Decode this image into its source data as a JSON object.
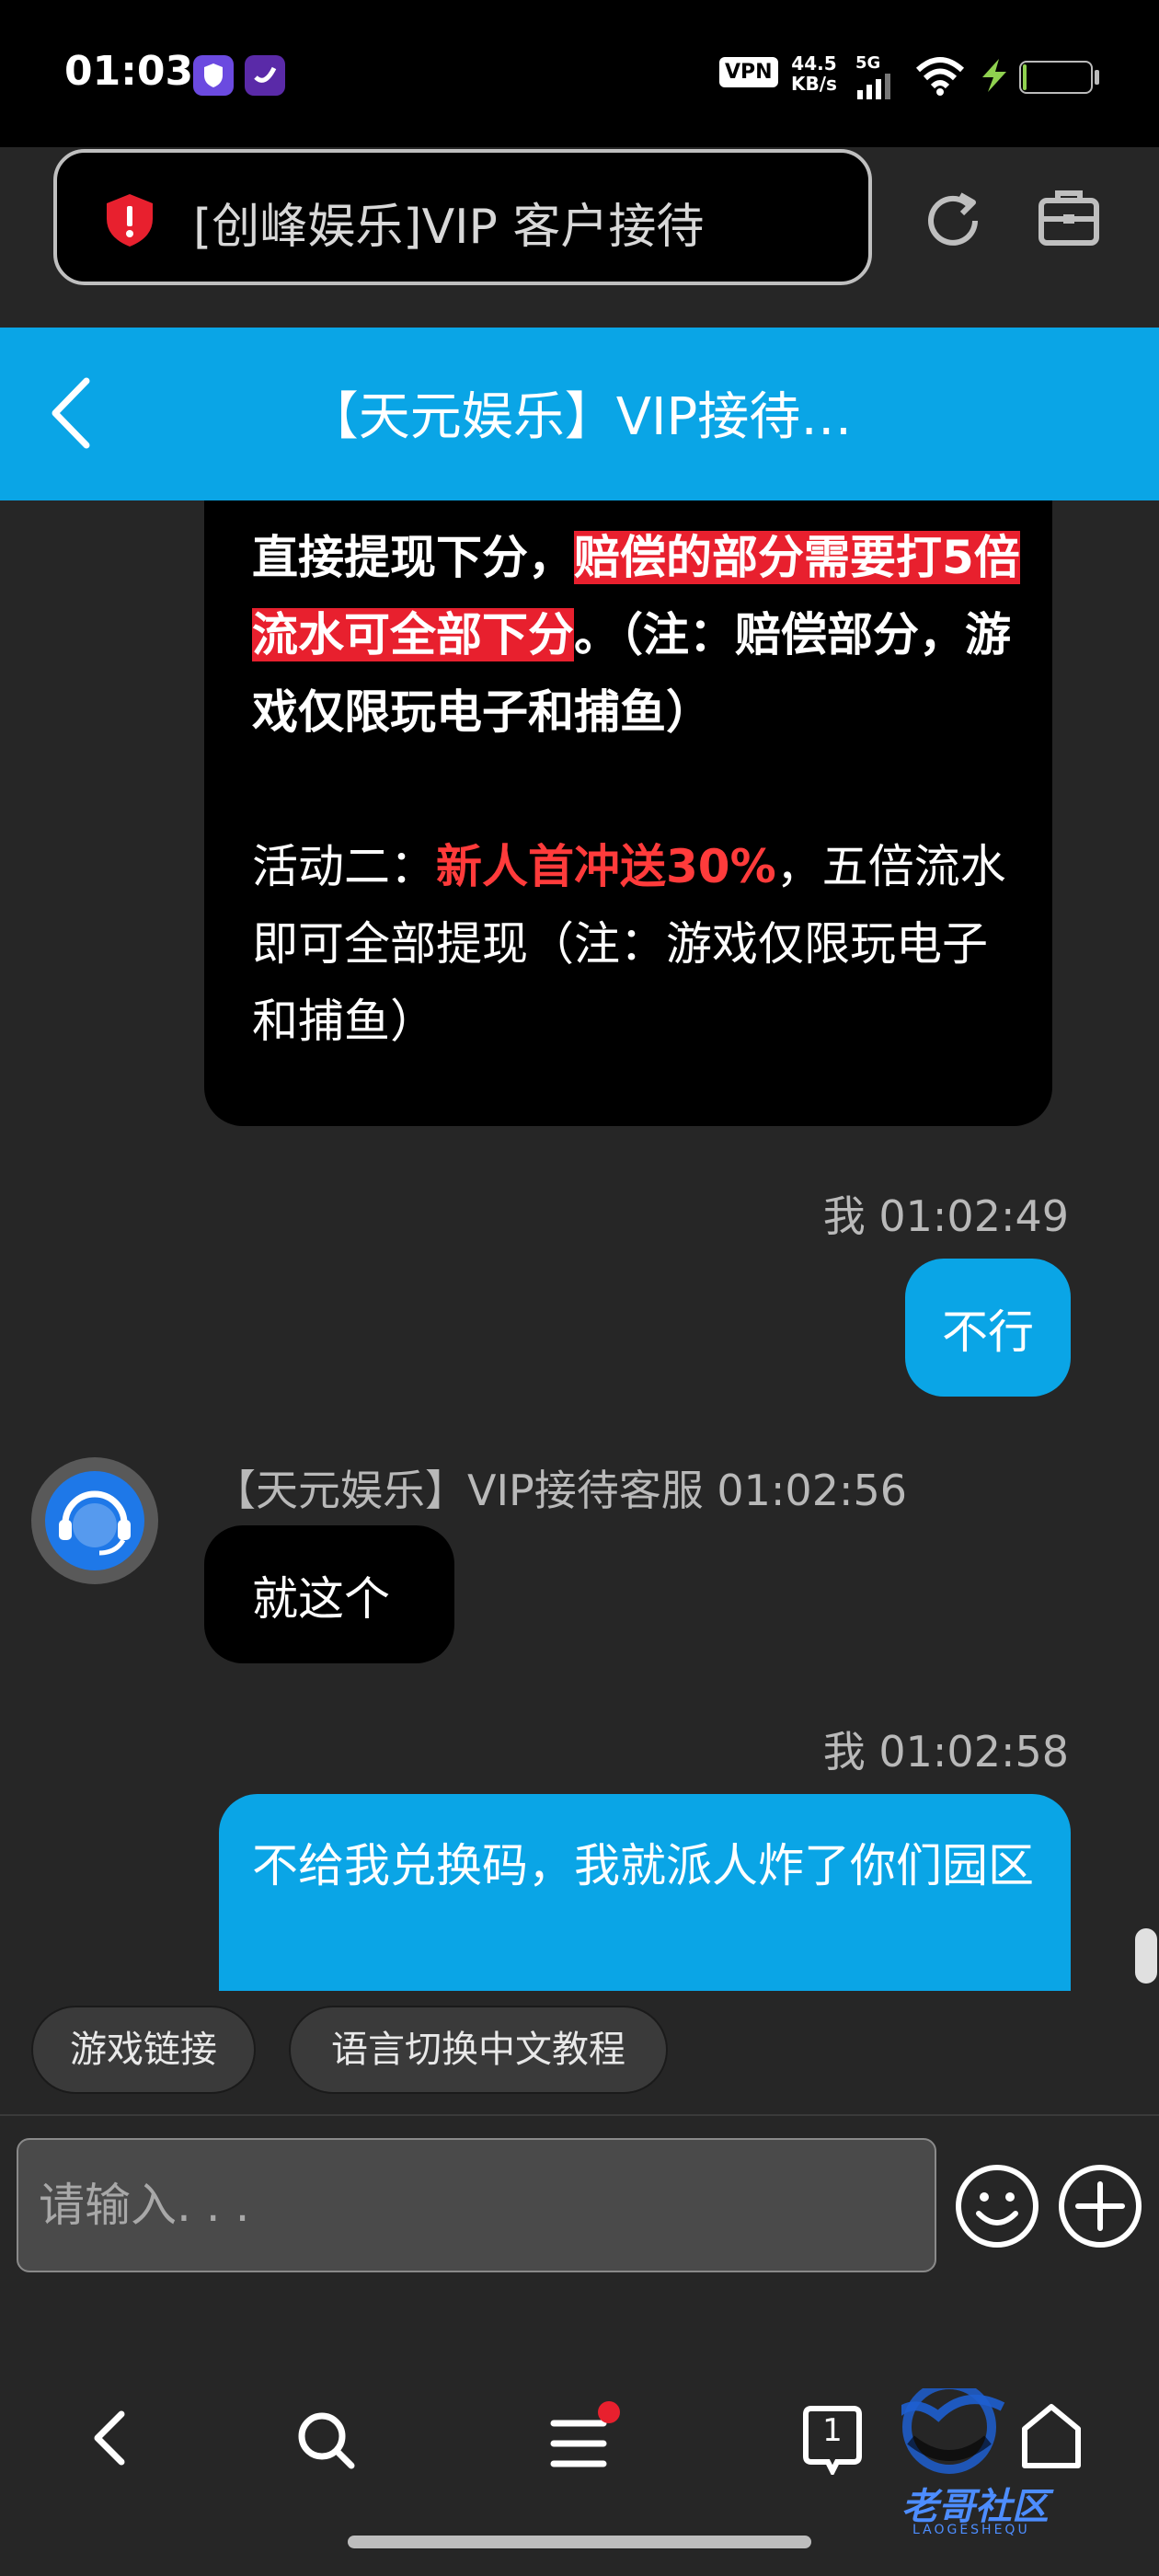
{
  "status_bar": {
    "time": "01:03",
    "vpn_label": "VPN",
    "net_speed_value": "44.5",
    "net_speed_unit": "KB/s",
    "signal_label": "5G",
    "battery_level": "11",
    "battery_fraction": 0.11
  },
  "browser": {
    "page_title": "[创峰娱乐]VIP 客户接待",
    "icons": [
      "shield-alert-icon",
      "refresh-icon",
      "briefcase-icon"
    ]
  },
  "chat_header": {
    "title": "【天元娱乐】VIP接待…"
  },
  "messages": {
    "m1": {
      "line_a_part1": "直接提现下分，",
      "line_a_highlight": "赔偿的部分需要打5倍流水可全部下分",
      "line_a_part2": "。（注：赔偿部分，游戏仅限玩电子和捕鱼）",
      "line_b_part1": "活动二：",
      "line_b_highlight": "新人首冲送30%",
      "line_b_part2": "，五倍流水即可全部提现（注：游戏仅限玩电子和捕鱼）"
    },
    "meta1": "我 01:02:49",
    "m2": "不行",
    "meta_agent": "【天元娱乐】VIP接待客服 01:02:56",
    "m3": "就这个",
    "meta2": "我 01:02:58",
    "m4": "不给我兑换码，我就派人炸了你们园区"
  },
  "quick_replies": [
    "游戏链接",
    "语言切换中文教程"
  ],
  "composer": {
    "placeholder": "请输入. . .",
    "icons": [
      "emoji-icon",
      "add-icon"
    ]
  },
  "nav_bar": {
    "tab_count": "1",
    "icons": [
      "back-icon",
      "search-icon",
      "menu-icon",
      "tabs-icon",
      "home-icon"
    ]
  },
  "watermark": {
    "text": "老哥社区",
    "subtext": "LAOGESHEQU"
  },
  "colors": {
    "accent": "#0aa5e6",
    "highlight_red": "#e8202e",
    "bubble_dark": "#000000",
    "background": "#262626"
  }
}
